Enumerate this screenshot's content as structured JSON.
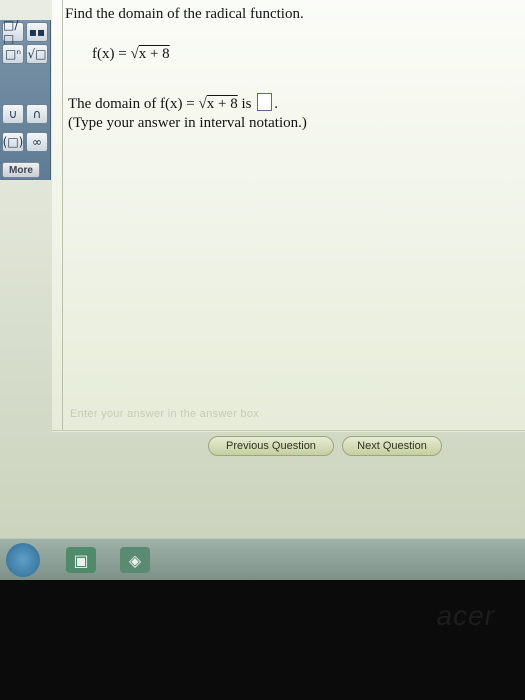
{
  "question": {
    "title": "Find the domain of the radical function.",
    "function_lhs": "f(x) = √",
    "function_radicand": "x + 8",
    "domain_prefix": "The domain of f(x) = √",
    "domain_radicand": "x + 8",
    "domain_suffix": " is",
    "domain_end": ".",
    "instruction": "(Type your answer in interval notation.)",
    "answer_value": ""
  },
  "palette": {
    "buttons": [
      "□/□",
      "▪▪",
      "□ⁿ",
      "√□",
      "∪",
      "∩",
      "(□)",
      "∞"
    ],
    "more_label": "More"
  },
  "footer": {
    "hint": "Enter your answer in the answer box",
    "prev_label": "Previous Question",
    "next_label": "Next Question"
  },
  "taskbar": {
    "icons": [
      "start-orb-icon",
      "app-icon",
      "app-icon"
    ]
  },
  "bezel": {
    "brand": "acer"
  }
}
